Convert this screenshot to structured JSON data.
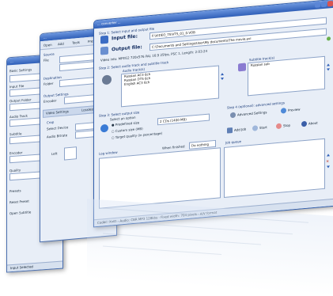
{
  "corner_text": "ı ı",
  "back_window": {
    "title": "...",
    "items": [
      "Basic Settings",
      "Input File",
      "Output Folder",
      "Audio Track",
      "Subtitle",
      "Encoder",
      "Quality",
      "Presets",
      "Reset Preset",
      "Open Subtitle",
      "Input Selected"
    ]
  },
  "mid_window": {
    "title": "...",
    "toolbar": [
      "Open",
      "Add",
      "Tools",
      "Presets"
    ],
    "sections": [
      "Source",
      "Destination",
      "Output Settings",
      "Crop",
      "Audio Bitrate"
    ],
    "tabs": [
      "Video Settings",
      "Lossless"
    ],
    "labels": [
      "File",
      "Folder",
      "Encoder",
      "Select Device",
      "Left"
    ]
  },
  "main_window": {
    "title": "... converter ...",
    "step1": "Step 1: Select input and output file",
    "input_label": "Input file:",
    "input_value": "F:\\VIDEO_TS\\VTS_01_0.VOB",
    "output_label": "Output file:",
    "output_value": "C:\\Documents and Settings\\User\\My documents\\The movie.avi",
    "video_info": "Video info: MPEG2 720x576 PAL 16:9 25fps, PSC 1, Length: 2:03:24",
    "step2": "Step 2: Select audio track and subtitle track",
    "audio_label": "Audio track(s)",
    "audio_tracks": [
      "Russian AC3 6ch",
      "Russian DTS 6ch",
      "English AC3 6ch"
    ],
    "subtitle_label": "Subtitle track(s)",
    "subtitle_tracks": [
      "Russian sub"
    ],
    "step3": "Step 3: Select output size",
    "select_option": "Select an option",
    "options": [
      "Predefined size",
      "Custom size (MB)",
      "Target quality (in percentage)"
    ],
    "predefined_value": "2 CDs (1400 MB)",
    "step4": "Step 4 (optional): advanced settings",
    "advanced_label": "Advanced Settings",
    "preview_label": "Preview",
    "actions": [
      "Add Job",
      "Start",
      "Stop",
      "About"
    ],
    "log_label": "Log window",
    "when_finished_label": "When finished",
    "when_finished_value": "Do nothing",
    "job_queue_label": "Job queue",
    "status_text": "Codec: XviD - Audio: CBR MP3 128kbs - Fixed width: 704 pixels - A/V format"
  },
  "colors": {
    "title_bar_top": "#6d97df",
    "title_bar_bottom": "#2f5fb8",
    "panel_bg": "#e8eef7"
  }
}
